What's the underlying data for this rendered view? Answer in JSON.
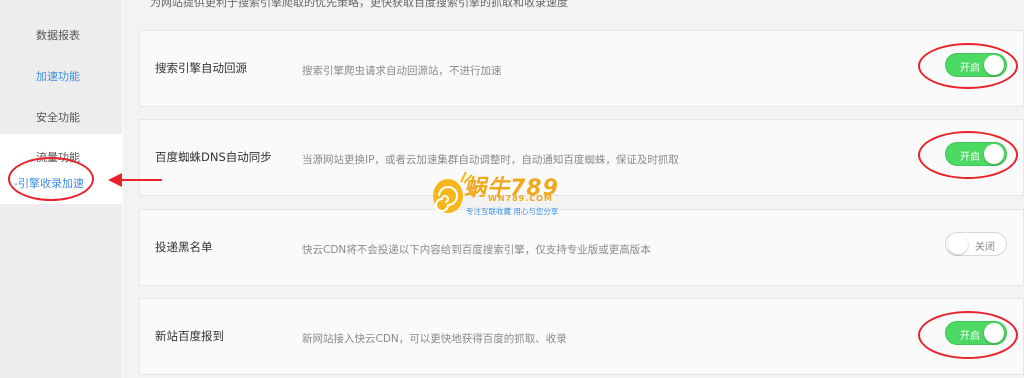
{
  "intro": "为网站提供更利于搜索引擎爬取的优先策略，更快获取百度搜索引擎的抓取和收录速度",
  "sidebar": {
    "items": [
      {
        "label": "数据报表"
      },
      {
        "label": "加速功能"
      },
      {
        "label": "安全功能"
      },
      {
        "label": "流量功能"
      },
      {
        "label": "-引擎收录加速"
      }
    ]
  },
  "settings": [
    {
      "title": "搜索引擎自动回源",
      "desc": "搜索引擎爬虫请求自动回源站，不进行加速",
      "state": "开启",
      "on": true
    },
    {
      "title": "百度蜘蛛DNS自动同步",
      "desc": "当源网站更换IP，或者云加速集群自动调整时，自动通知百度蜘蛛，保证及时抓取",
      "state": "开启",
      "on": true
    },
    {
      "title": "投递黑名单",
      "desc": "快云CDN将不会投递以下内容给到百度搜索引擎，仅支持专业版或更高版本",
      "state": "关闭",
      "on": false
    },
    {
      "title": "新站百度报到",
      "desc": "新网站接入快云CDN，可以更快地获得百度的抓取、收录",
      "state": "开启",
      "on": true
    }
  ],
  "watermark": {
    "brand": "蜗牛789",
    "domain": "WN789.COM",
    "slogan": "专注互联收藏  用心与您分享"
  },
  "colors": {
    "toggle_on": "#4cd964",
    "annotation_red": "#e8232b",
    "link_blue": "#3a8ee6"
  }
}
